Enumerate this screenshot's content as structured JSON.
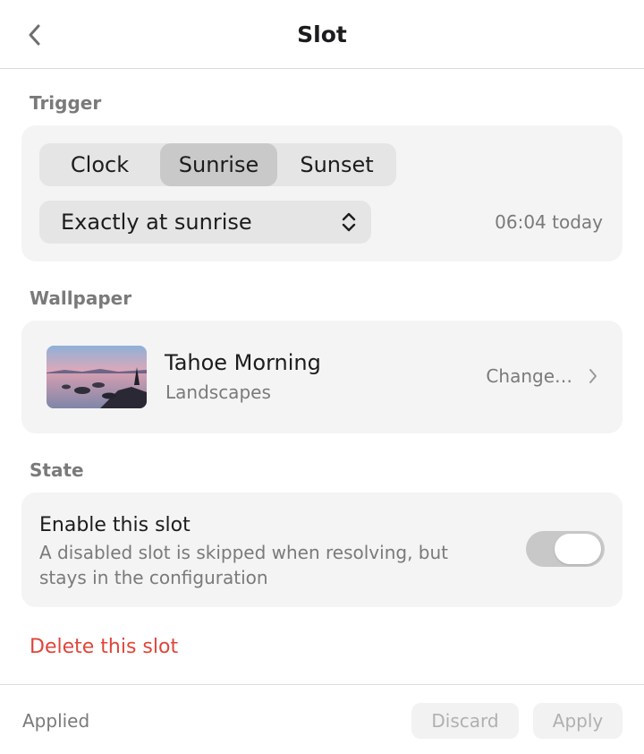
{
  "header": {
    "title": "Slot",
    "back_icon": "chevron-left-icon"
  },
  "trigger": {
    "label": "Trigger",
    "segments": [
      {
        "label": "Clock",
        "active": false
      },
      {
        "label": "Sunrise",
        "active": true
      },
      {
        "label": "Sunset",
        "active": false
      }
    ],
    "select_value": "Exactly at sunrise",
    "time_note": "06:04 today"
  },
  "wallpaper": {
    "label": "Wallpaper",
    "name": "Tahoe Morning",
    "category": "Landscapes",
    "change_label": "Change…"
  },
  "state": {
    "label": "State",
    "title": "Enable this slot",
    "description": "A disabled slot is skipped when resolving, but stays in the configuration",
    "enabled": true
  },
  "delete_label": "Delete this slot",
  "footer": {
    "status": "Applied",
    "discard_label": "Discard",
    "apply_label": "Apply"
  },
  "colors": {
    "accent_destructive": "#e0453a",
    "secondary_text": "#7a7a7a",
    "card_bg": "#f4f4f4"
  }
}
